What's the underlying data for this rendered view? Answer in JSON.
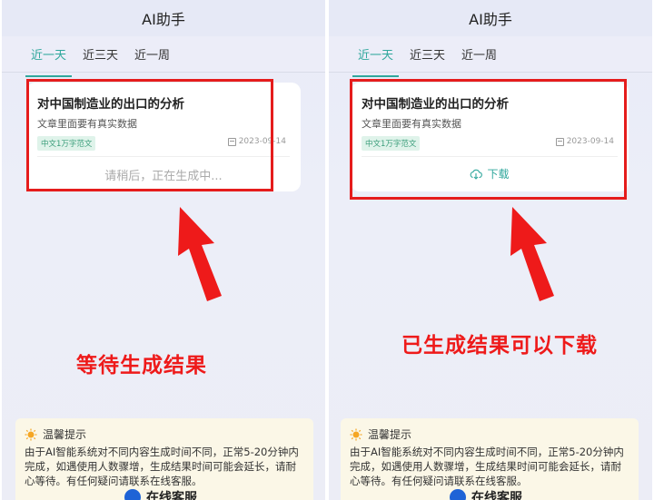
{
  "left": {
    "app_title": "AI助手",
    "tabs": [
      "近一天",
      "近三天",
      "近一周"
    ],
    "card": {
      "title": "对中国制造业的出口的分析",
      "subtitle": "文章里面要有真实数据",
      "tag": "中文1万字范文",
      "date": "2023-09-14",
      "status": "请稍后，正在生成中..."
    },
    "caption": "等待生成结果",
    "tips": {
      "title": "温馨提示",
      "body": "由于AI智能系统对不同内容生成时间不同，正常5-20分钟内完成，如遇使用人数骤增，生成结果时间可能会延长，请耐心等待。有任何疑问请联系在线客服。",
      "service_label": "在线客服"
    }
  },
  "right": {
    "app_title": "AI助手",
    "tabs": [
      "近一天",
      "近三天",
      "近一周"
    ],
    "card": {
      "title": "对中国制造业的出口的分析",
      "subtitle": "文章里面要有真实数据",
      "tag": "中文1万字范文",
      "date": "2023-09-14",
      "download_label": "下载"
    },
    "caption": "已生成结果可以下载",
    "tips": {
      "title": "温馨提示",
      "body": "由于AI智能系统对不同内容生成时间不同，正常5-20分钟内完成，如遇使用人数骤增，生成结果时间可能会延长，请耐心等待。有任何疑问请联系在线客服。",
      "service_label": "在线客服"
    }
  },
  "colors": {
    "accent": "#2fa79c",
    "annotation_red": "#e51c1c",
    "tip_background": "#fbf7e7"
  },
  "icons": [
    "lightbulb-icon",
    "calendar-icon",
    "cloud-download-icon",
    "headset-icon",
    "red-arrow"
  ]
}
